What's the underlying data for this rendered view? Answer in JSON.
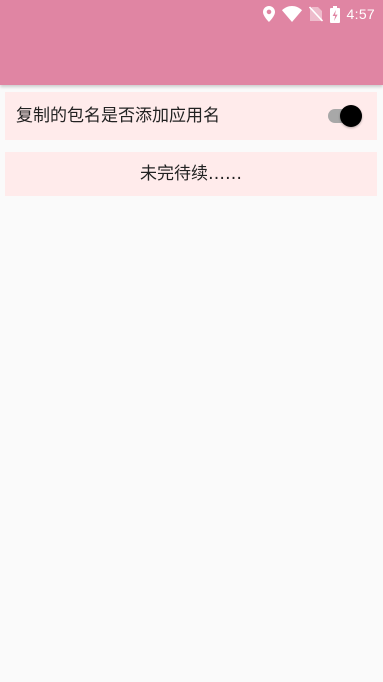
{
  "status_bar": {
    "time": "4:57",
    "icons": [
      "location-icon",
      "wifi-icon",
      "no-sim-icon",
      "battery-charging-icon"
    ]
  },
  "app_bar": {
    "color": "#e085a3"
  },
  "settings": {
    "append_app_name": {
      "label": "复制的包名是否添加应用名",
      "enabled": true
    }
  },
  "placeholder": {
    "text": "未完待续……"
  },
  "colors": {
    "card_background": "#ffebeb",
    "page_background": "#fafafa"
  }
}
